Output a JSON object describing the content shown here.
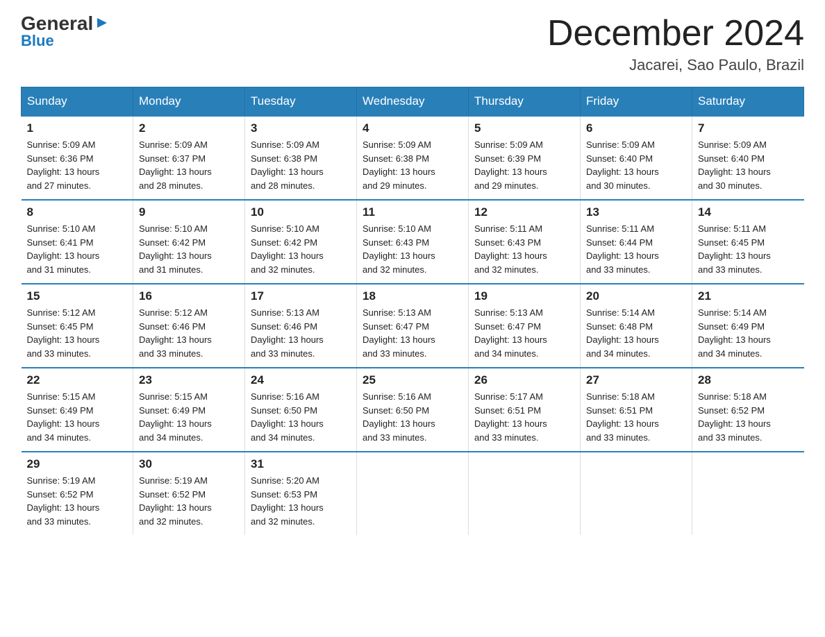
{
  "logo": {
    "general": "General",
    "arrow": "▶",
    "blue": "Blue"
  },
  "header": {
    "month_year": "December 2024",
    "location": "Jacarei, Sao Paulo, Brazil"
  },
  "weekdays": [
    "Sunday",
    "Monday",
    "Tuesday",
    "Wednesday",
    "Thursday",
    "Friday",
    "Saturday"
  ],
  "weeks": [
    [
      {
        "day": "1",
        "sunrise": "5:09 AM",
        "sunset": "6:36 PM",
        "daylight": "13 hours and 27 minutes."
      },
      {
        "day": "2",
        "sunrise": "5:09 AM",
        "sunset": "6:37 PM",
        "daylight": "13 hours and 28 minutes."
      },
      {
        "day": "3",
        "sunrise": "5:09 AM",
        "sunset": "6:38 PM",
        "daylight": "13 hours and 28 minutes."
      },
      {
        "day": "4",
        "sunrise": "5:09 AM",
        "sunset": "6:38 PM",
        "daylight": "13 hours and 29 minutes."
      },
      {
        "day": "5",
        "sunrise": "5:09 AM",
        "sunset": "6:39 PM",
        "daylight": "13 hours and 29 minutes."
      },
      {
        "day": "6",
        "sunrise": "5:09 AM",
        "sunset": "6:40 PM",
        "daylight": "13 hours and 30 minutes."
      },
      {
        "day": "7",
        "sunrise": "5:09 AM",
        "sunset": "6:40 PM",
        "daylight": "13 hours and 30 minutes."
      }
    ],
    [
      {
        "day": "8",
        "sunrise": "5:10 AM",
        "sunset": "6:41 PM",
        "daylight": "13 hours and 31 minutes."
      },
      {
        "day": "9",
        "sunrise": "5:10 AM",
        "sunset": "6:42 PM",
        "daylight": "13 hours and 31 minutes."
      },
      {
        "day": "10",
        "sunrise": "5:10 AM",
        "sunset": "6:42 PM",
        "daylight": "13 hours and 32 minutes."
      },
      {
        "day": "11",
        "sunrise": "5:10 AM",
        "sunset": "6:43 PM",
        "daylight": "13 hours and 32 minutes."
      },
      {
        "day": "12",
        "sunrise": "5:11 AM",
        "sunset": "6:43 PM",
        "daylight": "13 hours and 32 minutes."
      },
      {
        "day": "13",
        "sunrise": "5:11 AM",
        "sunset": "6:44 PM",
        "daylight": "13 hours and 33 minutes."
      },
      {
        "day": "14",
        "sunrise": "5:11 AM",
        "sunset": "6:45 PM",
        "daylight": "13 hours and 33 minutes."
      }
    ],
    [
      {
        "day": "15",
        "sunrise": "5:12 AM",
        "sunset": "6:45 PM",
        "daylight": "13 hours and 33 minutes."
      },
      {
        "day": "16",
        "sunrise": "5:12 AM",
        "sunset": "6:46 PM",
        "daylight": "13 hours and 33 minutes."
      },
      {
        "day": "17",
        "sunrise": "5:13 AM",
        "sunset": "6:46 PM",
        "daylight": "13 hours and 33 minutes."
      },
      {
        "day": "18",
        "sunrise": "5:13 AM",
        "sunset": "6:47 PM",
        "daylight": "13 hours and 33 minutes."
      },
      {
        "day": "19",
        "sunrise": "5:13 AM",
        "sunset": "6:47 PM",
        "daylight": "13 hours and 34 minutes."
      },
      {
        "day": "20",
        "sunrise": "5:14 AM",
        "sunset": "6:48 PM",
        "daylight": "13 hours and 34 minutes."
      },
      {
        "day": "21",
        "sunrise": "5:14 AM",
        "sunset": "6:49 PM",
        "daylight": "13 hours and 34 minutes."
      }
    ],
    [
      {
        "day": "22",
        "sunrise": "5:15 AM",
        "sunset": "6:49 PM",
        "daylight": "13 hours and 34 minutes."
      },
      {
        "day": "23",
        "sunrise": "5:15 AM",
        "sunset": "6:49 PM",
        "daylight": "13 hours and 34 minutes."
      },
      {
        "day": "24",
        "sunrise": "5:16 AM",
        "sunset": "6:50 PM",
        "daylight": "13 hours and 34 minutes."
      },
      {
        "day": "25",
        "sunrise": "5:16 AM",
        "sunset": "6:50 PM",
        "daylight": "13 hours and 33 minutes."
      },
      {
        "day": "26",
        "sunrise": "5:17 AM",
        "sunset": "6:51 PM",
        "daylight": "13 hours and 33 minutes."
      },
      {
        "day": "27",
        "sunrise": "5:18 AM",
        "sunset": "6:51 PM",
        "daylight": "13 hours and 33 minutes."
      },
      {
        "day": "28",
        "sunrise": "5:18 AM",
        "sunset": "6:52 PM",
        "daylight": "13 hours and 33 minutes."
      }
    ],
    [
      {
        "day": "29",
        "sunrise": "5:19 AM",
        "sunset": "6:52 PM",
        "daylight": "13 hours and 33 minutes."
      },
      {
        "day": "30",
        "sunrise": "5:19 AM",
        "sunset": "6:52 PM",
        "daylight": "13 hours and 32 minutes."
      },
      {
        "day": "31",
        "sunrise": "5:20 AM",
        "sunset": "6:53 PM",
        "daylight": "13 hours and 32 minutes."
      },
      null,
      null,
      null,
      null
    ]
  ]
}
